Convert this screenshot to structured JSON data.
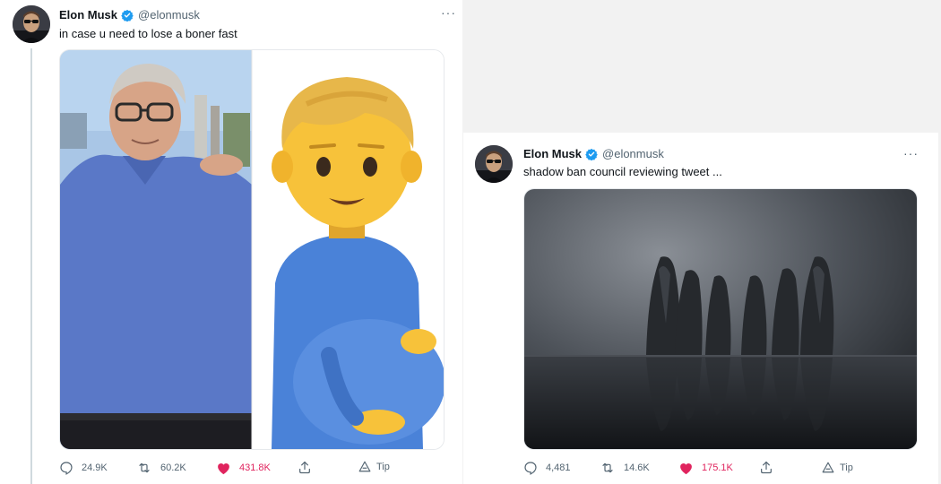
{
  "colors": {
    "verified": "#1d9bf0",
    "like": "#e0245e",
    "muted": "#536471",
    "pregnant_body": "#4a82d8",
    "emoji_skin": "#f7c23a"
  },
  "tweets": [
    {
      "author": {
        "name": "Elon Musk",
        "handle": "@elonmusk"
      },
      "text": "in case u need to lose a boner fast",
      "more": "···",
      "media_description": "side-by-side: man in blue polo shirt and pregnant man emoji",
      "stats": {
        "replies": "24.9K",
        "retweets": "60.2K",
        "likes": "431.8K",
        "tip": "Tip"
      },
      "liked": true
    },
    {
      "author": {
        "name": "Elon Musk",
        "handle": "@elonmusk"
      },
      "text": "shadow ban council reviewing tweet ...",
      "more": "···",
      "media_description": "hooded cloaked figures standing in dark water",
      "stats": {
        "replies": "4,481",
        "retweets": "14.6K",
        "likes": "175.1K",
        "tip": "Tip"
      },
      "liked": true
    }
  ],
  "icons": [
    "reply-icon",
    "retweet-icon",
    "like-icon",
    "share-icon",
    "tip-icon",
    "verified-badge-icon",
    "more-icon"
  ]
}
